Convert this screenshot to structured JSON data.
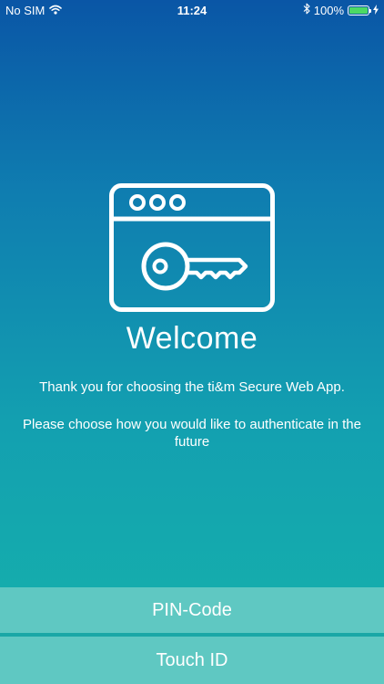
{
  "status_bar": {
    "carrier": "No SIM",
    "wifi_icon": "wifi-icon",
    "time": "11:24",
    "bluetooth_icon": "bluetooth-icon",
    "battery_percent": "100%",
    "battery_level": 1.0,
    "charging_icon": "lightning-icon"
  },
  "hero": {
    "icon": "browser-key-icon",
    "title": "Welcome"
  },
  "messages": {
    "thanks": "Thank you for choosing the ti&m Secure Web App.",
    "instruction": "Please choose how you would like to authenticate in the future"
  },
  "actions": {
    "pin_label": "PIN-Code",
    "touch_label": "Touch ID"
  },
  "colors": {
    "gradient_top": "#0a56a6",
    "gradient_bottom": "#16b3ab",
    "button_bg": "#5fc8c2",
    "battery_fill": "#4cd964"
  }
}
